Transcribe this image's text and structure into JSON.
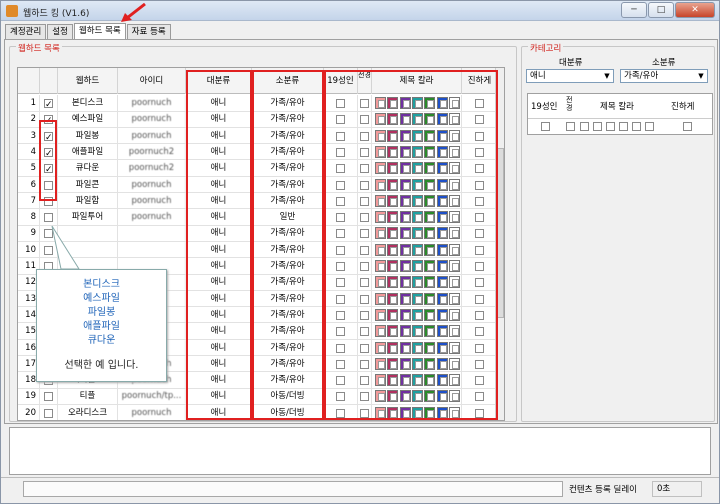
{
  "window": {
    "title": "웹하드 킹 (V1.6)",
    "min": "─",
    "max": "□",
    "close": "✕"
  },
  "tabs": [
    "계정관리",
    "설정",
    "웹하드 목록",
    "자료 등록"
  ],
  "active_tab": 2,
  "list_group": {
    "title": "웹하드 목록"
  },
  "table": {
    "headers": {
      "webhard": "웹하드",
      "id": "아이디",
      "major": "대분류",
      "minor": "소분류",
      "adult": "19성인",
      "hide": "전경",
      "title_color": "제목 칼라",
      "bold": "진하게"
    },
    "rows": [
      {
        "n": "1",
        "checked": true,
        "name": "본디스크",
        "id": "poornuch",
        "major": "애니",
        "minor": "가족/유아"
      },
      {
        "n": "2",
        "checked": true,
        "name": "예스파일",
        "id": "poornuch",
        "major": "애니",
        "minor": "가족/유아"
      },
      {
        "n": "3",
        "checked": true,
        "name": "파일봉",
        "id": "poornuch",
        "major": "애니",
        "minor": "가족/유아"
      },
      {
        "n": "4",
        "checked": true,
        "name": "애플파일",
        "id": "poornuch2",
        "major": "애니",
        "minor": "가족/유아"
      },
      {
        "n": "5",
        "checked": true,
        "name": "큐다운",
        "id": "poornuch2",
        "major": "애니",
        "minor": "가족/유아"
      },
      {
        "n": "6",
        "checked": false,
        "name": "파일콘",
        "id": "poornuch",
        "major": "애니",
        "minor": "가족/유아"
      },
      {
        "n": "7",
        "checked": false,
        "name": "파일함",
        "id": "poornuch",
        "major": "애니",
        "minor": "가족/유아"
      },
      {
        "n": "8",
        "checked": false,
        "name": "파일투어",
        "id": "poornuch",
        "major": "애니",
        "minor": "일반"
      },
      {
        "n": "9",
        "checked": false,
        "name": "",
        "id": "",
        "major": "애니",
        "minor": "가족/유아"
      },
      {
        "n": "10",
        "checked": false,
        "name": "",
        "id": "",
        "major": "애니",
        "minor": "가족/유아"
      },
      {
        "n": "11",
        "checked": false,
        "name": "",
        "id": "",
        "major": "애니",
        "minor": "가족/유아"
      },
      {
        "n": "12",
        "checked": false,
        "name": "",
        "id": "",
        "major": "애니",
        "minor": "가족/유아"
      },
      {
        "n": "13",
        "checked": false,
        "name": "",
        "id": "",
        "major": "애니",
        "minor": "가족/유아"
      },
      {
        "n": "14",
        "checked": false,
        "name": "",
        "id": "",
        "major": "애니",
        "minor": "가족/유아"
      },
      {
        "n": "15",
        "checked": false,
        "name": "",
        "id": "",
        "major": "애니",
        "minor": "가족/유아"
      },
      {
        "n": "16",
        "checked": false,
        "name": "",
        "id": "",
        "major": "애니",
        "minor": "가족/유아"
      },
      {
        "n": "17",
        "checked": false,
        "name": "조이파일",
        "id": "poornuch",
        "major": "애니",
        "minor": "가족/유아"
      },
      {
        "n": "18",
        "checked": false,
        "name": "럭키월드",
        "id": "poornuch",
        "major": "애니",
        "minor": "가족/유아"
      },
      {
        "n": "19",
        "checked": false,
        "name": "티플",
        "id": "poornuch/tp...",
        "major": "애니",
        "minor": "아동/더빙"
      },
      {
        "n": "20",
        "checked": false,
        "name": "오라디스크",
        "id": "poornuch",
        "major": "애니",
        "minor": "아동/더빙"
      }
    ],
    "swatch_colors": [
      "#f29a9a",
      "#b03060",
      "#7030a0",
      "#20a0a0",
      "#2a8a2a",
      "#1e50c8",
      "#ffffff"
    ]
  },
  "callout": {
    "lines": [
      "본디스크",
      "예스파일",
      "파일봉",
      "애플파일",
      "큐다운"
    ],
    "ending": "선택한 예 입니다."
  },
  "category": {
    "title": "카테고리",
    "major_label": "대분류",
    "minor_label": "소분류",
    "major_value": "애니",
    "minor_value": "가족/유아",
    "headers": {
      "adult": "19성인",
      "hide": "전경",
      "title_color": "제목 칼라",
      "bold": "진하게"
    }
  },
  "status": {
    "label": "컨텐츠 등록 딜레이",
    "value": "0초"
  },
  "colors": {
    "accent_red": "#e02020",
    "group_title": "#d0201a"
  }
}
